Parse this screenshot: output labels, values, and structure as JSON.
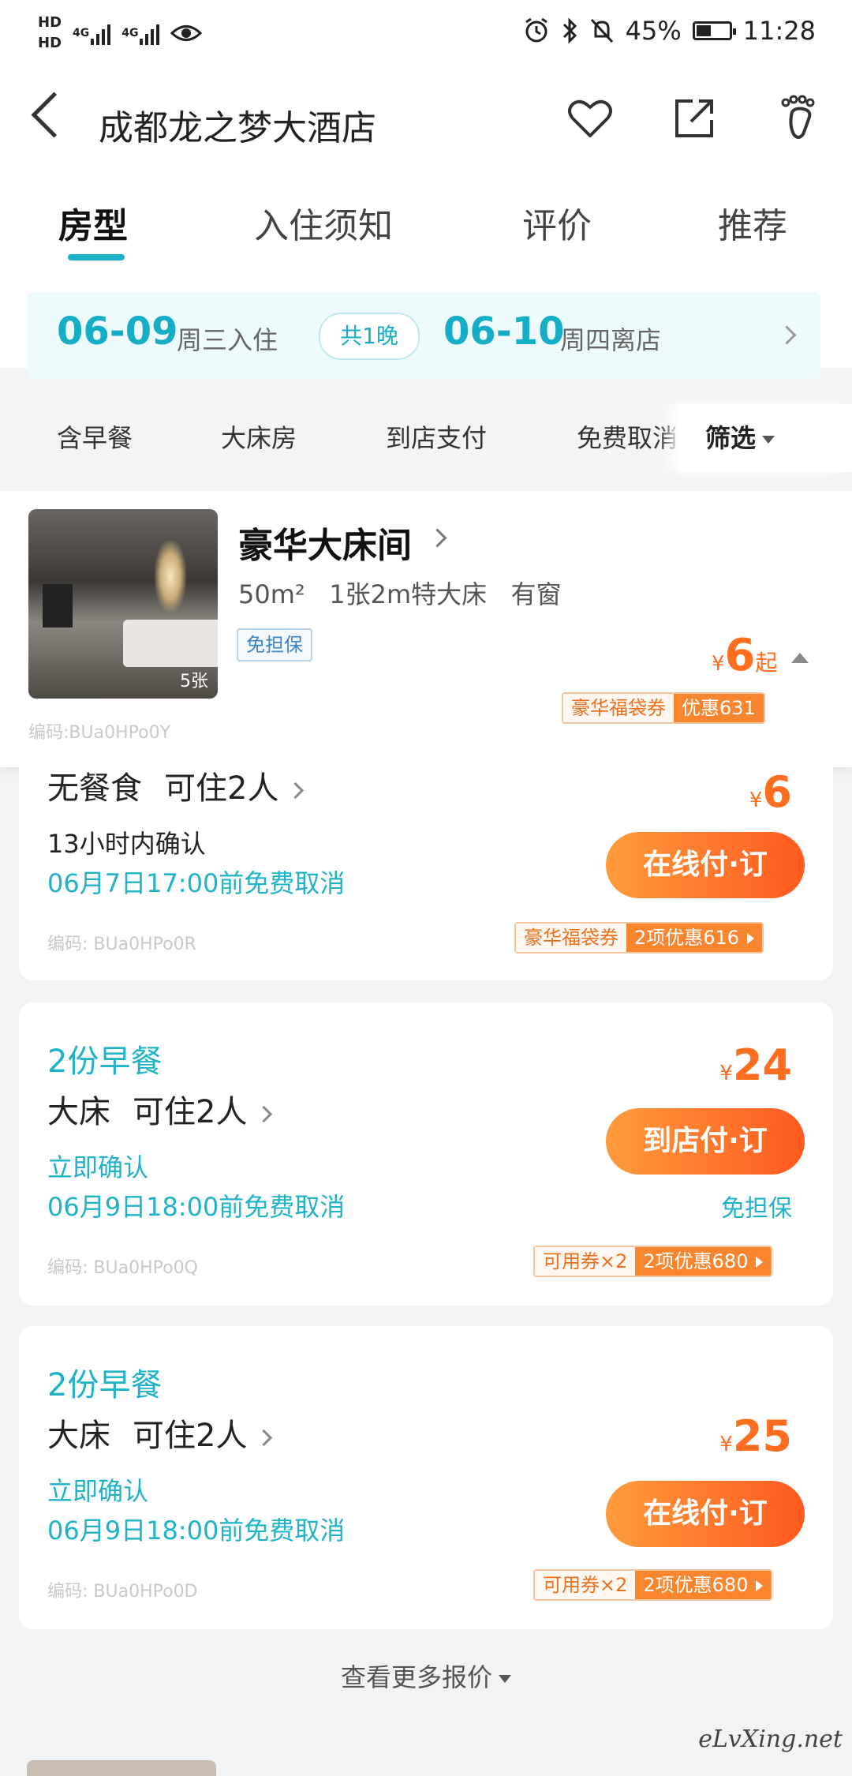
{
  "status_bar": {
    "hd_top": "HD",
    "hd_bottom": "HD",
    "net1": "4G",
    "net2": "4G",
    "battery_text": "45%",
    "time": "11:28"
  },
  "header": {
    "back_icon": "chevron-left-icon",
    "title": "成都龙之梦大酒店",
    "icons": [
      "heart-icon",
      "share-icon",
      "footprint-icon"
    ]
  },
  "tabs": [
    "房型",
    "入住须知",
    "评价",
    "推荐"
  ],
  "date_bar": {
    "checkin_date": "06-09",
    "checkin_label": "周三入住",
    "nights": "共1晚",
    "checkout_date": "06-10",
    "checkout_label": "周四离店"
  },
  "filters": {
    "chips": [
      "含早餐",
      "大床房",
      "到店支付",
      "免费取消"
    ],
    "screen_label": "筛选"
  },
  "room": {
    "name": "豪华大床间",
    "area": "50m²",
    "bed": "1张2m特大床",
    "window": "有窗",
    "tag": "免担保",
    "photo_count": "5张",
    "price_symbol": "¥",
    "price": "6",
    "price_suffix": "起",
    "coupon_left": "豪华福袋券",
    "coupon_right": "优惠631",
    "code": "编码:BUa0HPo0Y"
  },
  "offers": [
    {
      "meal": "",
      "bed": "无餐食",
      "occupancy": "可住2人",
      "confirm": "13小时内确认",
      "cancel": "06月7日17:00前免费取消",
      "price_symbol": "¥",
      "price": "6",
      "button": "在线付·订",
      "free_guarantee": "",
      "coupon_left": "豪华福袋券",
      "coupon_right": "2项优惠616",
      "code": "编码: BUa0HPo0R"
    },
    {
      "meal": "2份早餐",
      "bed": "大床",
      "occupancy": "可住2人",
      "confirm": "立即确认",
      "cancel": "06月9日18:00前免费取消",
      "price_symbol": "¥",
      "price": "24",
      "button": "到店付·订",
      "free_guarantee": "免担保",
      "coupon_left": "可用券×2",
      "coupon_right": "2项优惠680",
      "code": "编码: BUa0HPo0Q"
    },
    {
      "meal": "2份早餐",
      "bed": "大床",
      "occupancy": "可住2人",
      "confirm": "立即确认",
      "cancel": "06月9日18:00前免费取消",
      "price_symbol": "¥",
      "price": "25",
      "button": "在线付·订",
      "free_guarantee": "",
      "coupon_left": "可用券×2",
      "coupon_right": "2项优惠680",
      "code": "编码: BUa0HPo0D"
    }
  ],
  "more_label": "查看更多报价",
  "watermark": "eLvXing.net",
  "colors": {
    "accent": "#19b3c5",
    "price": "#ff6d1f",
    "button_start": "#ff9b3c",
    "button_end": "#ff5a1f"
  }
}
